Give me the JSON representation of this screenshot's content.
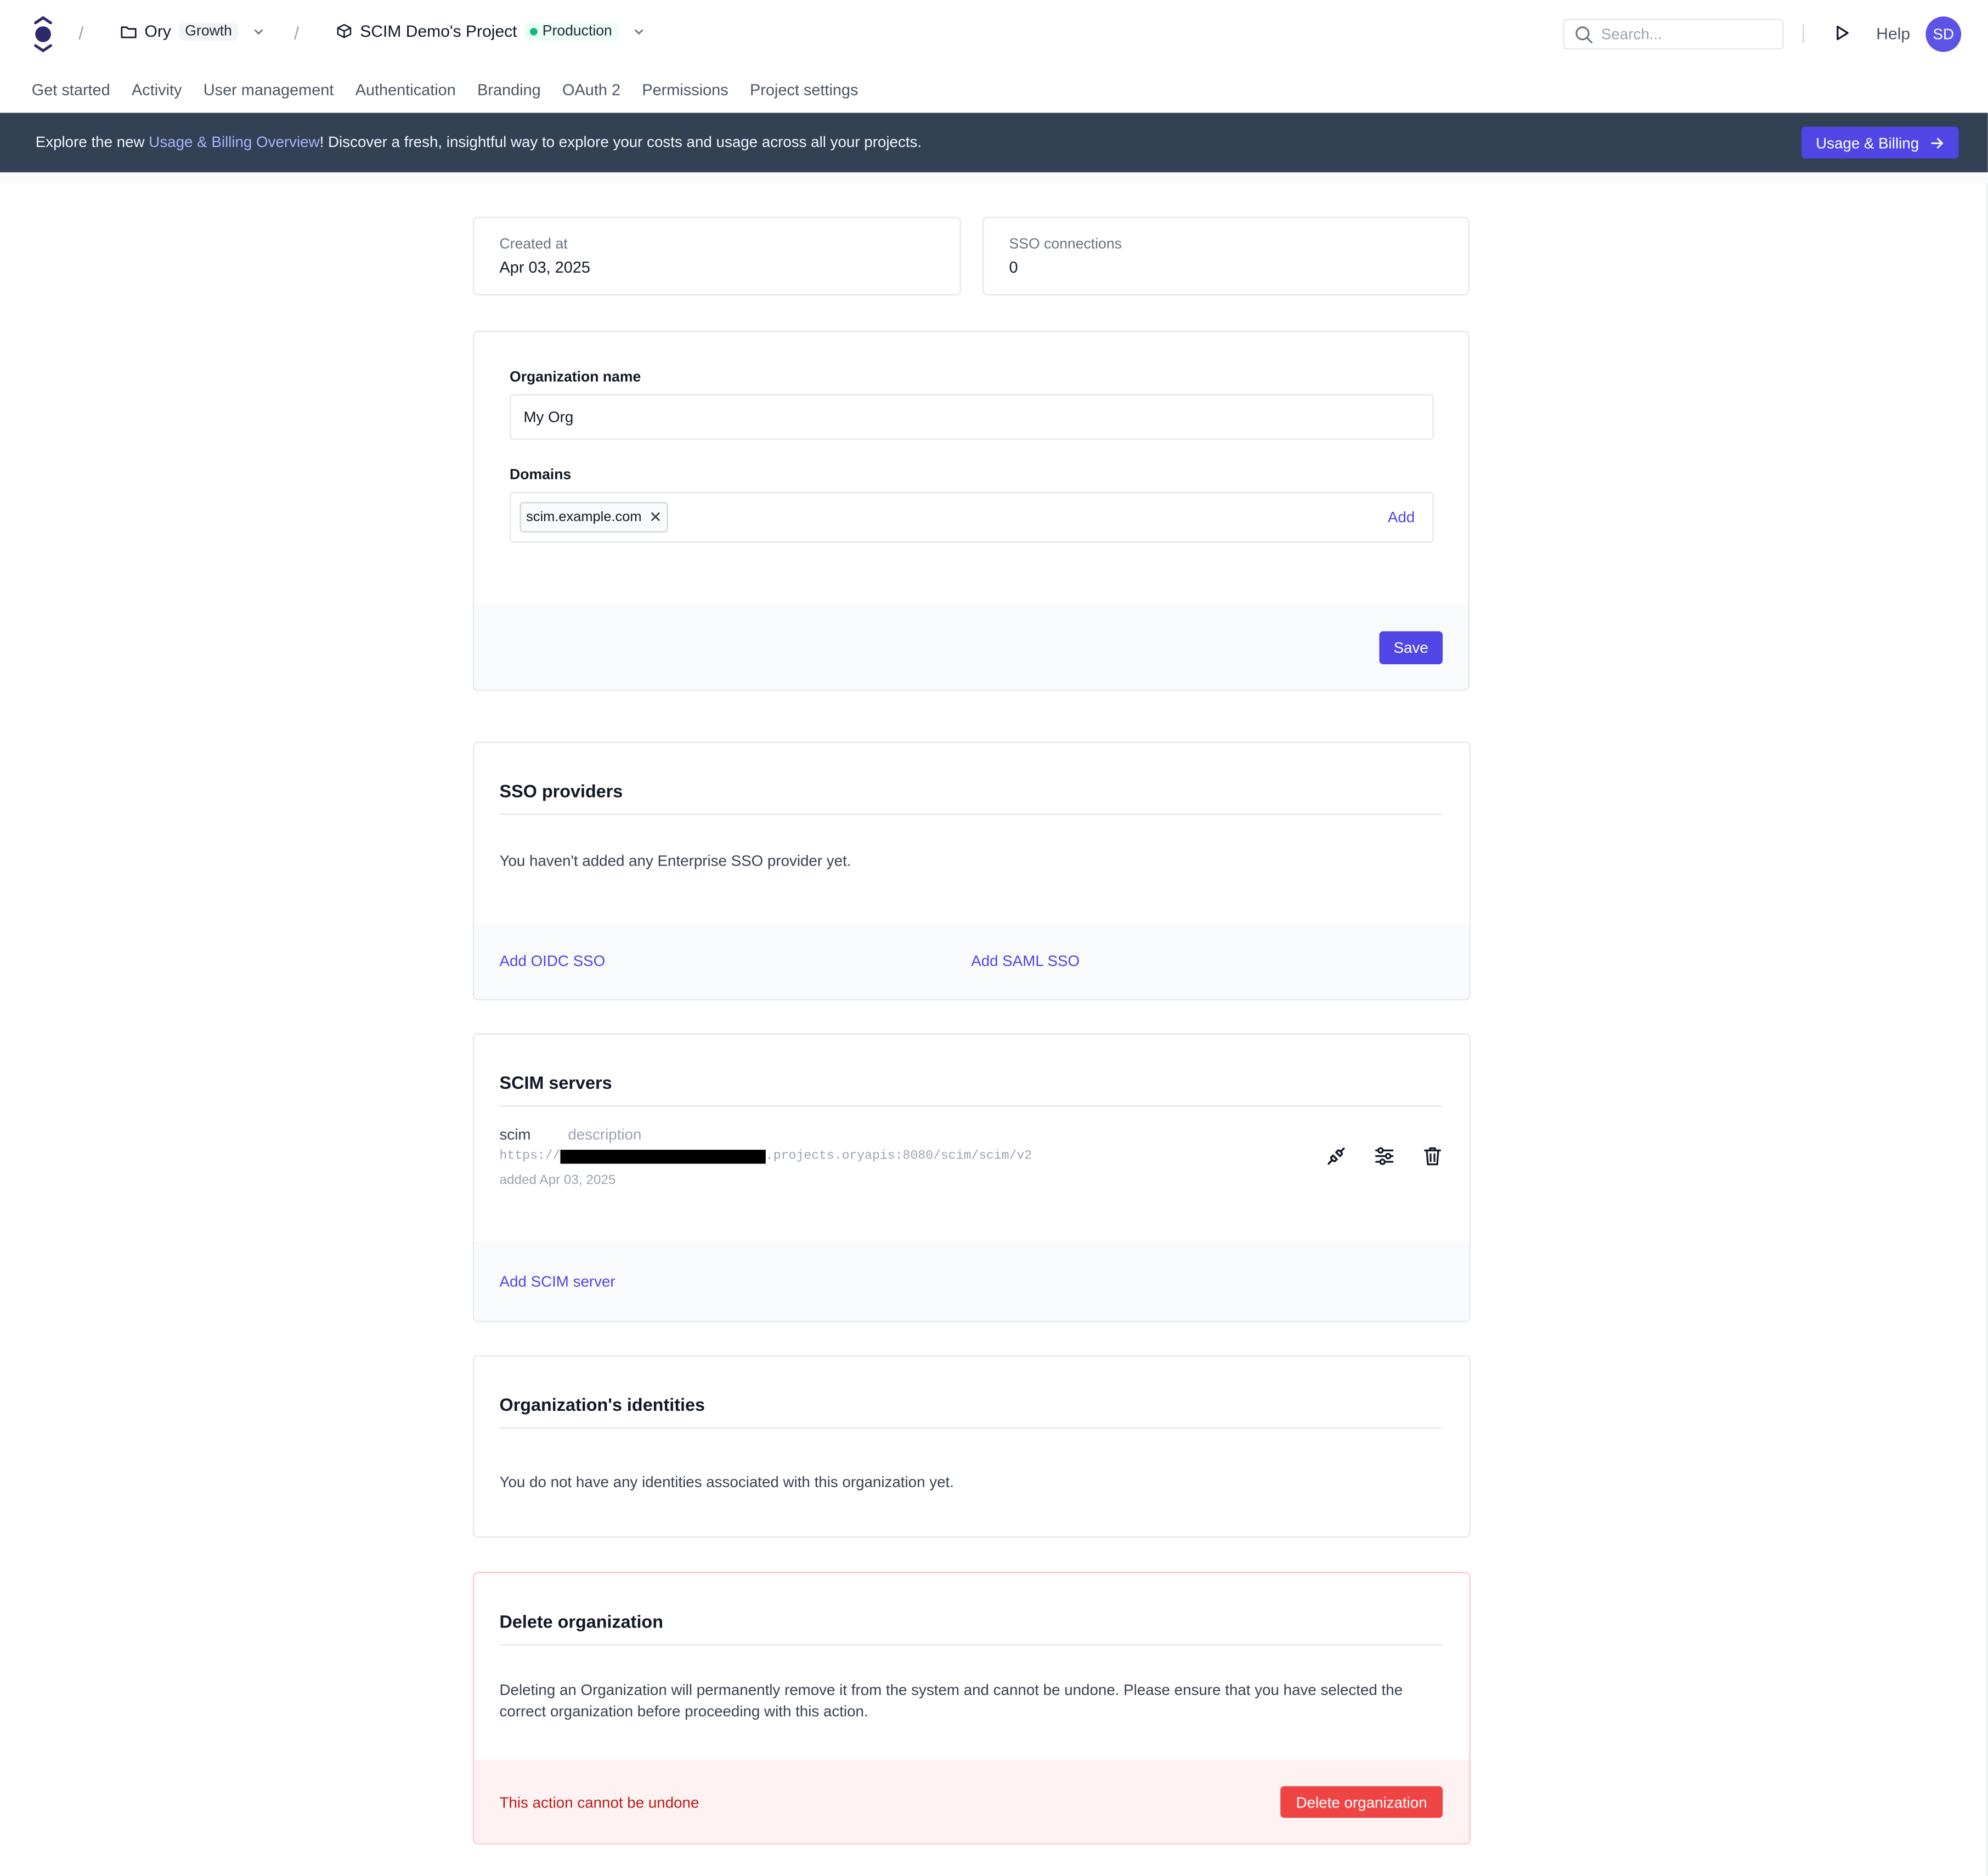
{
  "header": {
    "org_name": "Ory",
    "org_plan": "Growth",
    "project_name": "SCIM Demo's Project",
    "project_env": "Production",
    "search_placeholder": "Search...",
    "help_label": "Help",
    "avatar_initials": "SD"
  },
  "nav": {
    "items": [
      "Get started",
      "Activity",
      "User management",
      "Authentication",
      "Branding",
      "OAuth 2",
      "Permissions",
      "Project settings"
    ]
  },
  "banner": {
    "prefix": "Explore the new ",
    "link": "Usage & Billing Overview",
    "suffix": "! Discover a fresh, insightful way to explore your costs and usage across all your projects.",
    "button_label": "Usage & Billing"
  },
  "stats": {
    "created_label": "Created at",
    "created_value": "Apr 03, 2025",
    "sso_label": "SSO connections",
    "sso_value": "0"
  },
  "org_form": {
    "name_label": "Organization name",
    "name_value": "My Org",
    "domains_label": "Domains",
    "domains": [
      "scim.example.com"
    ],
    "add_label": "Add",
    "save_label": "Save"
  },
  "sso": {
    "title": "SSO providers",
    "empty_text": "You haven't added any Enterprise SSO provider yet.",
    "add_oidc": "Add OIDC SSO",
    "add_saml": "Add SAML SSO"
  },
  "scim": {
    "title": "SCIM servers",
    "server_name": "scim",
    "server_description": "description",
    "url_prefix": "https://",
    "url_suffix": ".projects.oryapis:8080/scim/scim/v2",
    "added": "added Apr 03, 2025",
    "add_label": "Add SCIM server"
  },
  "identities": {
    "title": "Organization's identities",
    "empty_text": "You do not have any identities associated with this organization yet."
  },
  "delete": {
    "title": "Delete organization",
    "text": "Deleting an Organization will permanently remove it from the system and cannot be undone. Please ensure that you have selected the correct organization before proceeding with this action.",
    "warning": "This action cannot be undone",
    "button_label": "Delete organization"
  },
  "colors": {
    "accent": "#4f46e5",
    "banner": "#334155",
    "danger": "#dc2626",
    "env_dot": "#10b981"
  }
}
